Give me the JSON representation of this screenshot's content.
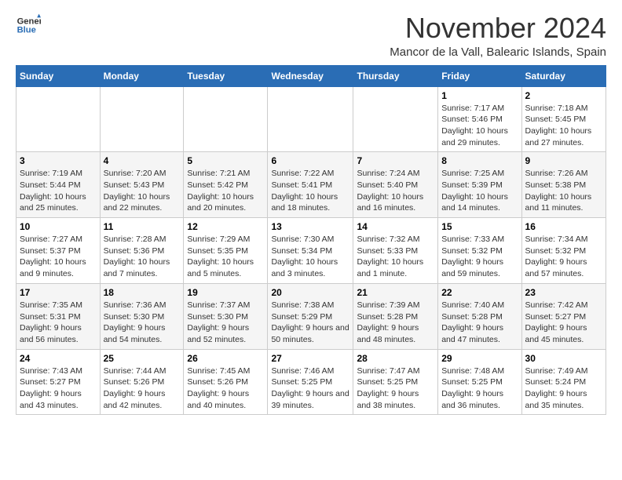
{
  "logo": {
    "general": "General",
    "blue": "Blue"
  },
  "header": {
    "title": "November 2024",
    "subtitle": "Mancor de la Vall, Balearic Islands, Spain"
  },
  "weekdays": [
    "Sunday",
    "Monday",
    "Tuesday",
    "Wednesday",
    "Thursday",
    "Friday",
    "Saturday"
  ],
  "weeks": [
    [
      {
        "day": "",
        "info": ""
      },
      {
        "day": "",
        "info": ""
      },
      {
        "day": "",
        "info": ""
      },
      {
        "day": "",
        "info": ""
      },
      {
        "day": "",
        "info": ""
      },
      {
        "day": "1",
        "info": "Sunrise: 7:17 AM\nSunset: 5:46 PM\nDaylight: 10 hours and 29 minutes."
      },
      {
        "day": "2",
        "info": "Sunrise: 7:18 AM\nSunset: 5:45 PM\nDaylight: 10 hours and 27 minutes."
      }
    ],
    [
      {
        "day": "3",
        "info": "Sunrise: 7:19 AM\nSunset: 5:44 PM\nDaylight: 10 hours and 25 minutes."
      },
      {
        "day": "4",
        "info": "Sunrise: 7:20 AM\nSunset: 5:43 PM\nDaylight: 10 hours and 22 minutes."
      },
      {
        "day": "5",
        "info": "Sunrise: 7:21 AM\nSunset: 5:42 PM\nDaylight: 10 hours and 20 minutes."
      },
      {
        "day": "6",
        "info": "Sunrise: 7:22 AM\nSunset: 5:41 PM\nDaylight: 10 hours and 18 minutes."
      },
      {
        "day": "7",
        "info": "Sunrise: 7:24 AM\nSunset: 5:40 PM\nDaylight: 10 hours and 16 minutes."
      },
      {
        "day": "8",
        "info": "Sunrise: 7:25 AM\nSunset: 5:39 PM\nDaylight: 10 hours and 14 minutes."
      },
      {
        "day": "9",
        "info": "Sunrise: 7:26 AM\nSunset: 5:38 PM\nDaylight: 10 hours and 11 minutes."
      }
    ],
    [
      {
        "day": "10",
        "info": "Sunrise: 7:27 AM\nSunset: 5:37 PM\nDaylight: 10 hours and 9 minutes."
      },
      {
        "day": "11",
        "info": "Sunrise: 7:28 AM\nSunset: 5:36 PM\nDaylight: 10 hours and 7 minutes."
      },
      {
        "day": "12",
        "info": "Sunrise: 7:29 AM\nSunset: 5:35 PM\nDaylight: 10 hours and 5 minutes."
      },
      {
        "day": "13",
        "info": "Sunrise: 7:30 AM\nSunset: 5:34 PM\nDaylight: 10 hours and 3 minutes."
      },
      {
        "day": "14",
        "info": "Sunrise: 7:32 AM\nSunset: 5:33 PM\nDaylight: 10 hours and 1 minute."
      },
      {
        "day": "15",
        "info": "Sunrise: 7:33 AM\nSunset: 5:32 PM\nDaylight: 9 hours and 59 minutes."
      },
      {
        "day": "16",
        "info": "Sunrise: 7:34 AM\nSunset: 5:32 PM\nDaylight: 9 hours and 57 minutes."
      }
    ],
    [
      {
        "day": "17",
        "info": "Sunrise: 7:35 AM\nSunset: 5:31 PM\nDaylight: 9 hours and 56 minutes."
      },
      {
        "day": "18",
        "info": "Sunrise: 7:36 AM\nSunset: 5:30 PM\nDaylight: 9 hours and 54 minutes."
      },
      {
        "day": "19",
        "info": "Sunrise: 7:37 AM\nSunset: 5:30 PM\nDaylight: 9 hours and 52 minutes."
      },
      {
        "day": "20",
        "info": "Sunrise: 7:38 AM\nSunset: 5:29 PM\nDaylight: 9 hours and 50 minutes."
      },
      {
        "day": "21",
        "info": "Sunrise: 7:39 AM\nSunset: 5:28 PM\nDaylight: 9 hours and 48 minutes."
      },
      {
        "day": "22",
        "info": "Sunrise: 7:40 AM\nSunset: 5:28 PM\nDaylight: 9 hours and 47 minutes."
      },
      {
        "day": "23",
        "info": "Sunrise: 7:42 AM\nSunset: 5:27 PM\nDaylight: 9 hours and 45 minutes."
      }
    ],
    [
      {
        "day": "24",
        "info": "Sunrise: 7:43 AM\nSunset: 5:27 PM\nDaylight: 9 hours and 43 minutes."
      },
      {
        "day": "25",
        "info": "Sunrise: 7:44 AM\nSunset: 5:26 PM\nDaylight: 9 hours and 42 minutes."
      },
      {
        "day": "26",
        "info": "Sunrise: 7:45 AM\nSunset: 5:26 PM\nDaylight: 9 hours and 40 minutes."
      },
      {
        "day": "27",
        "info": "Sunrise: 7:46 AM\nSunset: 5:25 PM\nDaylight: 9 hours and 39 minutes."
      },
      {
        "day": "28",
        "info": "Sunrise: 7:47 AM\nSunset: 5:25 PM\nDaylight: 9 hours and 38 minutes."
      },
      {
        "day": "29",
        "info": "Sunrise: 7:48 AM\nSunset: 5:25 PM\nDaylight: 9 hours and 36 minutes."
      },
      {
        "day": "30",
        "info": "Sunrise: 7:49 AM\nSunset: 5:24 PM\nDaylight: 9 hours and 35 minutes."
      }
    ]
  ]
}
